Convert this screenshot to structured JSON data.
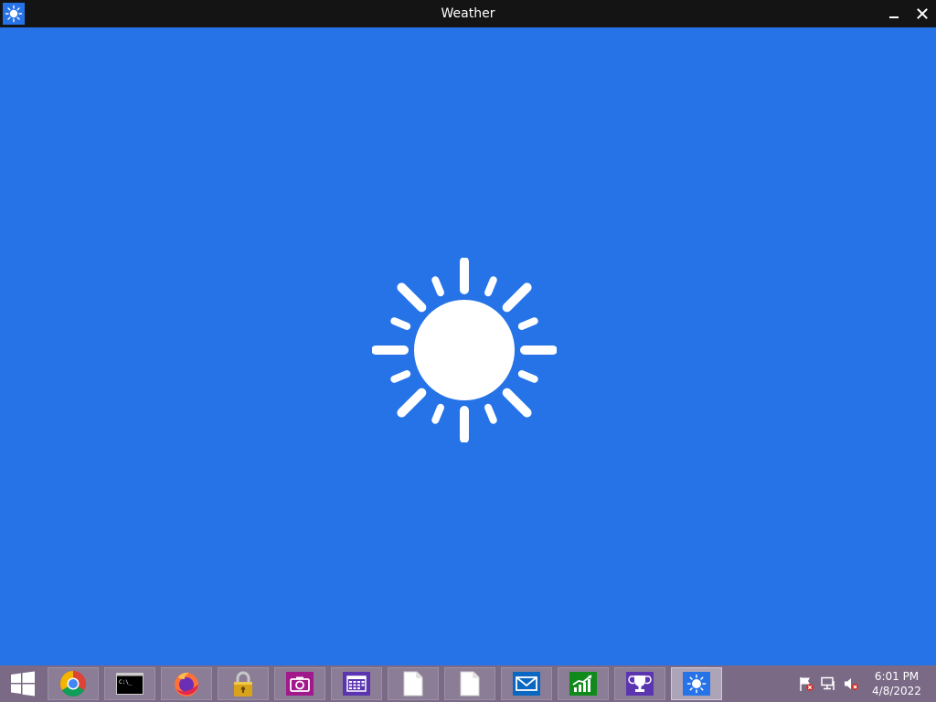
{
  "window": {
    "title": "Weather",
    "icon": "sun-icon",
    "controls": [
      "minimize-icon",
      "close-icon"
    ]
  },
  "colors": {
    "accent": "#2673e8",
    "titlebar": "#141414",
    "taskbar": "#7a6a86"
  },
  "main": {
    "splash_icon": "sun-icon"
  },
  "taskbar": {
    "start_icon": "windows-logo-icon",
    "apps": [
      {
        "name": "chrome",
        "icon": "chrome-icon",
        "active": false
      },
      {
        "name": "command-prompt",
        "icon": "command-prompt-icon",
        "active": false
      },
      {
        "name": "firefox",
        "icon": "firefox-icon",
        "active": false
      },
      {
        "name": "security",
        "icon": "padlock-icon",
        "active": false
      },
      {
        "name": "camera",
        "icon": "camera-icon",
        "active": false
      },
      {
        "name": "calendar",
        "icon": "calendar-icon",
        "active": false
      },
      {
        "name": "document-1",
        "icon": "document-icon",
        "active": false
      },
      {
        "name": "document-2",
        "icon": "document-icon",
        "active": false
      },
      {
        "name": "mail",
        "icon": "mail-icon",
        "active": false
      },
      {
        "name": "finance",
        "icon": "chart-icon",
        "active": false
      },
      {
        "name": "trophy",
        "icon": "trophy-icon",
        "active": false
      },
      {
        "name": "weather",
        "icon": "sun-icon",
        "active": true
      }
    ],
    "tray": {
      "icons": [
        "action-center-flag-icon",
        "network-icon",
        "volume-muted-icon"
      ],
      "time": "6:01 PM",
      "date": "4/8/2022"
    }
  }
}
